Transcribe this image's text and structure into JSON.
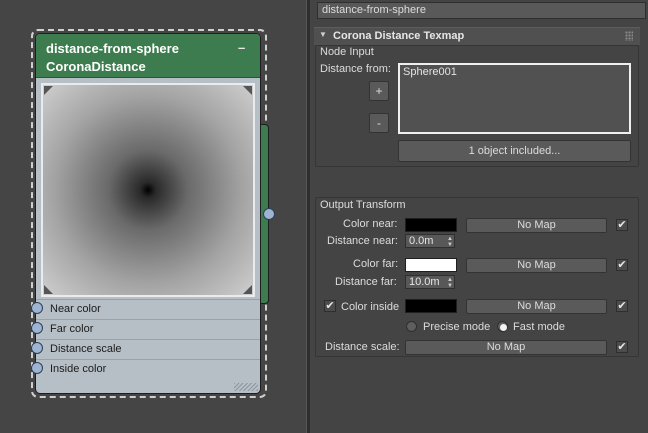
{
  "node": {
    "title": "distance-from-sphere",
    "subtitle": "CoronaDistance",
    "collapse_glyph": "–",
    "inputs": [
      {
        "label": "Near color"
      },
      {
        "label": "Far color"
      },
      {
        "label": "Distance scale"
      },
      {
        "label": "Inside color"
      }
    ],
    "header_color": "#3d7c4e"
  },
  "panel": {
    "name_field": "distance-from-sphere",
    "rollout": {
      "arrow": "▼",
      "title": "Corona Distance Texmap"
    },
    "node_input": {
      "group_label": "Node Input",
      "distance_from_label": "Distance from:",
      "add_button": "+",
      "remove_button": "-",
      "objects": [
        "Sphere001"
      ],
      "included_button": "1 object included..."
    },
    "output_transform": {
      "group_label": "Output Transform",
      "color_near_label": "Color near:",
      "color_near_swatch": "#000000",
      "color_near_map": "No Map",
      "color_near_checked": true,
      "distance_near_label": "Distance near:",
      "distance_near_value": "0.0m",
      "color_far_label": "Color far:",
      "color_far_swatch": "#ffffff",
      "color_far_map": "No Map",
      "color_far_checked": true,
      "distance_far_label": "Distance far:",
      "distance_far_value": "10.0m",
      "color_inside_label": "Color inside",
      "color_inside_enabled": true,
      "color_inside_swatch": "#000000",
      "color_inside_map": "No Map",
      "color_inside_checked": true,
      "mode_precise_label": "Precise mode",
      "mode_fast_label": "Fast mode",
      "mode_selected": "Fast mode",
      "distance_scale_label": "Distance scale:",
      "distance_scale_map": "No Map",
      "distance_scale_checked": true
    },
    "check_glyph": "✔",
    "spin_up": "▲",
    "spin_down": "▼"
  }
}
